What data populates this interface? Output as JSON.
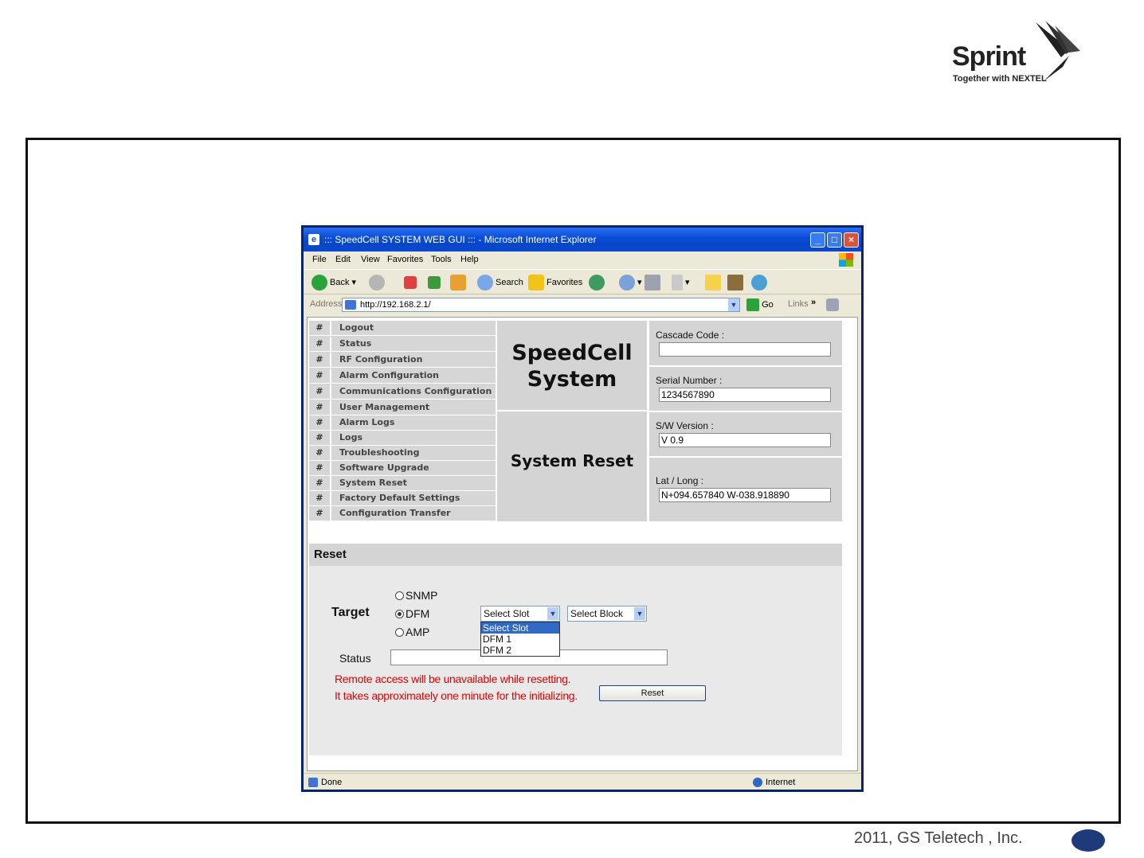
{
  "slide": {
    "logo_word": "Sprint",
    "logo_tagline": "Together with NEXTEL",
    "footer": "2011, GS Teletech , Inc."
  },
  "window": {
    "title": "::: SpeedCell SYSTEM WEB GUI ::: - Microsoft Internet Explorer",
    "menu": [
      "File",
      "Edit",
      "View",
      "Favorites",
      "Tools",
      "Help"
    ],
    "toolbar": {
      "back": "Back",
      "search": "Search",
      "favorites": "Favorites"
    },
    "address_label": "Address",
    "address_value": "http://192.168.2.1/",
    "go": "Go",
    "links": "Links",
    "status_left": "Done",
    "status_right": "Internet"
  },
  "nav": {
    "hash": "#",
    "items": [
      "Logout",
      "Status",
      "RF Configuration",
      "Alarm Configuration",
      "Communications Configuration",
      "User Management",
      "Alarm Logs",
      "Logs",
      "Troubleshooting",
      "Software Upgrade",
      "System Reset",
      "Factory Default Settings",
      "Configuration Transfer"
    ]
  },
  "brand": {
    "title": "SpeedCell System",
    "page": "System Reset"
  },
  "info": {
    "cascade_label": "Cascade Code :",
    "cascade_value": "",
    "serial_label": "Serial Number :",
    "serial_value": "1234567890",
    "sw_label": "S/W Version :",
    "sw_value": "V 0.9",
    "latlong_label": "Lat / Long :",
    "latlong_value": "N+094.657840 W-038.918890"
  },
  "reset": {
    "header": "Reset",
    "target_label": "Target",
    "targets": [
      "SNMP",
      "DFM",
      "AMP"
    ],
    "selected_target": "DFM",
    "slot_select": "Select Slot",
    "block_select": "Select Block",
    "slot_options": [
      "Select Slot",
      "DFM 1",
      "DFM 2"
    ],
    "status_label": "Status",
    "warning1": "Remote access will be unavailable while resetting.",
    "warning2": "It takes approximately one minute for the initializing.",
    "button": "Reset"
  }
}
